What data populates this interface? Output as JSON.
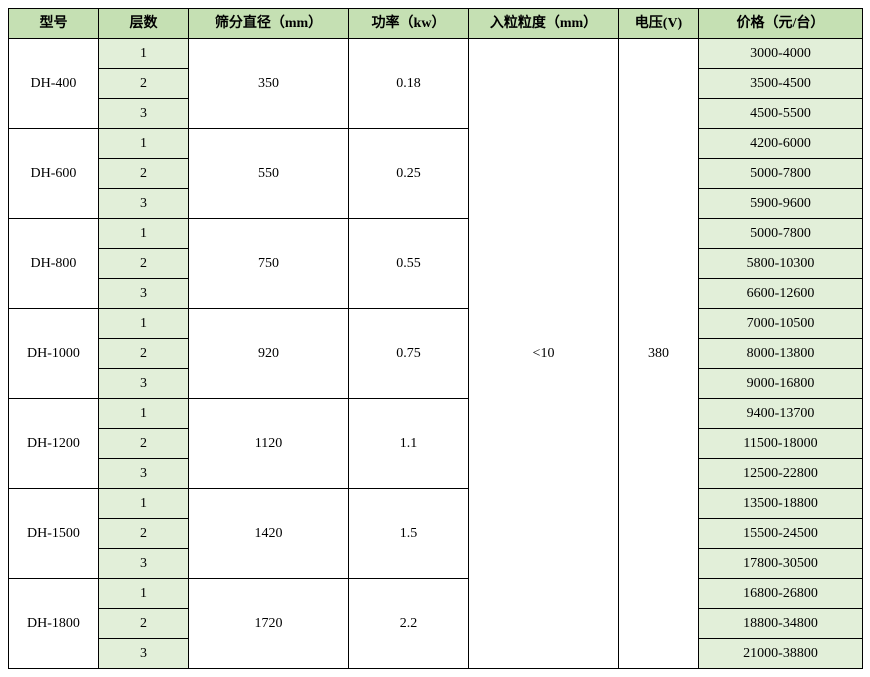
{
  "headers": {
    "model": "型号",
    "layers": "层数",
    "diameter": "筛分直径（mm）",
    "power": "功率（kw）",
    "particle": "入粒粒度（mm）",
    "voltage": "电压(V)",
    "price": "价格（元/台）"
  },
  "shared": {
    "particle": "<10",
    "voltage": "380"
  },
  "models": [
    {
      "model": "DH-400",
      "diameter": "350",
      "power": "0.18",
      "rows": [
        {
          "layers": "1",
          "price": "3000-4000"
        },
        {
          "layers": "2",
          "price": "3500-4500"
        },
        {
          "layers": "3",
          "price": "4500-5500"
        }
      ]
    },
    {
      "model": "DH-600",
      "diameter": "550",
      "power": "0.25",
      "rows": [
        {
          "layers": "1",
          "price": "4200-6000"
        },
        {
          "layers": "2",
          "price": "5000-7800"
        },
        {
          "layers": "3",
          "price": "5900-9600"
        }
      ]
    },
    {
      "model": "DH-800",
      "diameter": "750",
      "power": "0.55",
      "rows": [
        {
          "layers": "1",
          "price": "5000-7800"
        },
        {
          "layers": "2",
          "price": "5800-10300"
        },
        {
          "layers": "3",
          "price": "6600-12600"
        }
      ]
    },
    {
      "model": "DH-1000",
      "diameter": "920",
      "power": "0.75",
      "rows": [
        {
          "layers": "1",
          "price": "7000-10500"
        },
        {
          "layers": "2",
          "price": "8000-13800"
        },
        {
          "layers": "3",
          "price": "9000-16800"
        }
      ]
    },
    {
      "model": "DH-1200",
      "diameter": "1120",
      "power": "1.1",
      "rows": [
        {
          "layers": "1",
          "price": "9400-13700"
        },
        {
          "layers": "2",
          "price": "11500-18000"
        },
        {
          "layers": "3",
          "price": "12500-22800"
        }
      ]
    },
    {
      "model": "DH-1500",
      "diameter": "1420",
      "power": "1.5",
      "rows": [
        {
          "layers": "1",
          "price": "13500-18800"
        },
        {
          "layers": "2",
          "price": "15500-24500"
        },
        {
          "layers": "3",
          "price": "17800-30500"
        }
      ]
    },
    {
      "model": "DH-1800",
      "diameter": "1720",
      "power": "2.2",
      "rows": [
        {
          "layers": "1",
          "price": "16800-26800"
        },
        {
          "layers": "2",
          "price": "18800-34800"
        },
        {
          "layers": "3",
          "price": "21000-38800"
        }
      ]
    }
  ]
}
